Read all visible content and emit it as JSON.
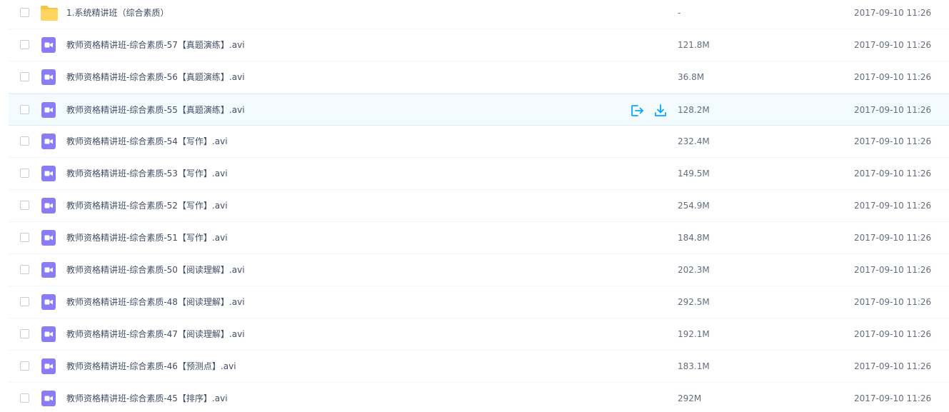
{
  "colors": {
    "folder": "#ffd560",
    "folder_tab": "#f7c247",
    "video": "#8a7cf4",
    "action_blue": "#06a7ff",
    "hover_bg": "#f4fbff"
  },
  "files": [
    {
      "name": "1.系统精讲班（综合素质）",
      "size": "-",
      "date": "2017-09-10 11:26",
      "icon": "folder-icon"
    },
    {
      "name": "教师资格精讲班-综合素质-57【真题演练】.avi",
      "size": "121.8M",
      "date": "2017-09-10 11:26",
      "icon": "video-file-icon"
    },
    {
      "name": "教师资格精讲班-综合素质-56【真题演练】.avi",
      "size": "36.8M",
      "date": "2017-09-10 11:26",
      "icon": "video-file-icon"
    },
    {
      "name": "教师资格精讲班-综合素质-55【真题演练】.avi",
      "size": "128.2M",
      "date": "2017-09-10 11:26",
      "icon": "video-file-icon",
      "hovered": true
    },
    {
      "name": "教师资格精讲班-综合素质-54【写作】.avi",
      "size": "232.4M",
      "date": "2017-09-10 11:26",
      "icon": "video-file-icon"
    },
    {
      "name": "教师资格精讲班-综合素质-53【写作】.avi",
      "size": "149.5M",
      "date": "2017-09-10 11:26",
      "icon": "video-file-icon"
    },
    {
      "name": "教师资格精讲班-综合素质-52【写作】.avi",
      "size": "254.9M",
      "date": "2017-09-10 11:26",
      "icon": "video-file-icon"
    },
    {
      "name": "教师资格精讲班-综合素质-51【写作】.avi",
      "size": "184.8M",
      "date": "2017-09-10 11:26",
      "icon": "video-file-icon"
    },
    {
      "name": "教师资格精讲班-综合素质-50【阅读理解】.avi",
      "size": "202.3M",
      "date": "2017-09-10 11:26",
      "icon": "video-file-icon"
    },
    {
      "name": "教师资格精讲班-综合素质-48【阅读理解】.avi",
      "size": "292.5M",
      "date": "2017-09-10 11:26",
      "icon": "video-file-icon"
    },
    {
      "name": "教师资格精讲班-综合素质-47【阅读理解】.avi",
      "size": "192.1M",
      "date": "2017-09-10 11:26",
      "icon": "video-file-icon"
    },
    {
      "name": "教师资格精讲班-综合素质-46【预测点】.avi",
      "size": "183.1M",
      "date": "2017-09-10 11:26",
      "icon": "video-file-icon"
    },
    {
      "name": "教师资格精讲班-综合素质-45【排序】.avi",
      "size": "292M",
      "date": "2017-09-10 11:26",
      "icon": "video-file-icon"
    }
  ],
  "hover_actions": {
    "share_icon": "share-icon",
    "download_icon": "download-icon"
  }
}
